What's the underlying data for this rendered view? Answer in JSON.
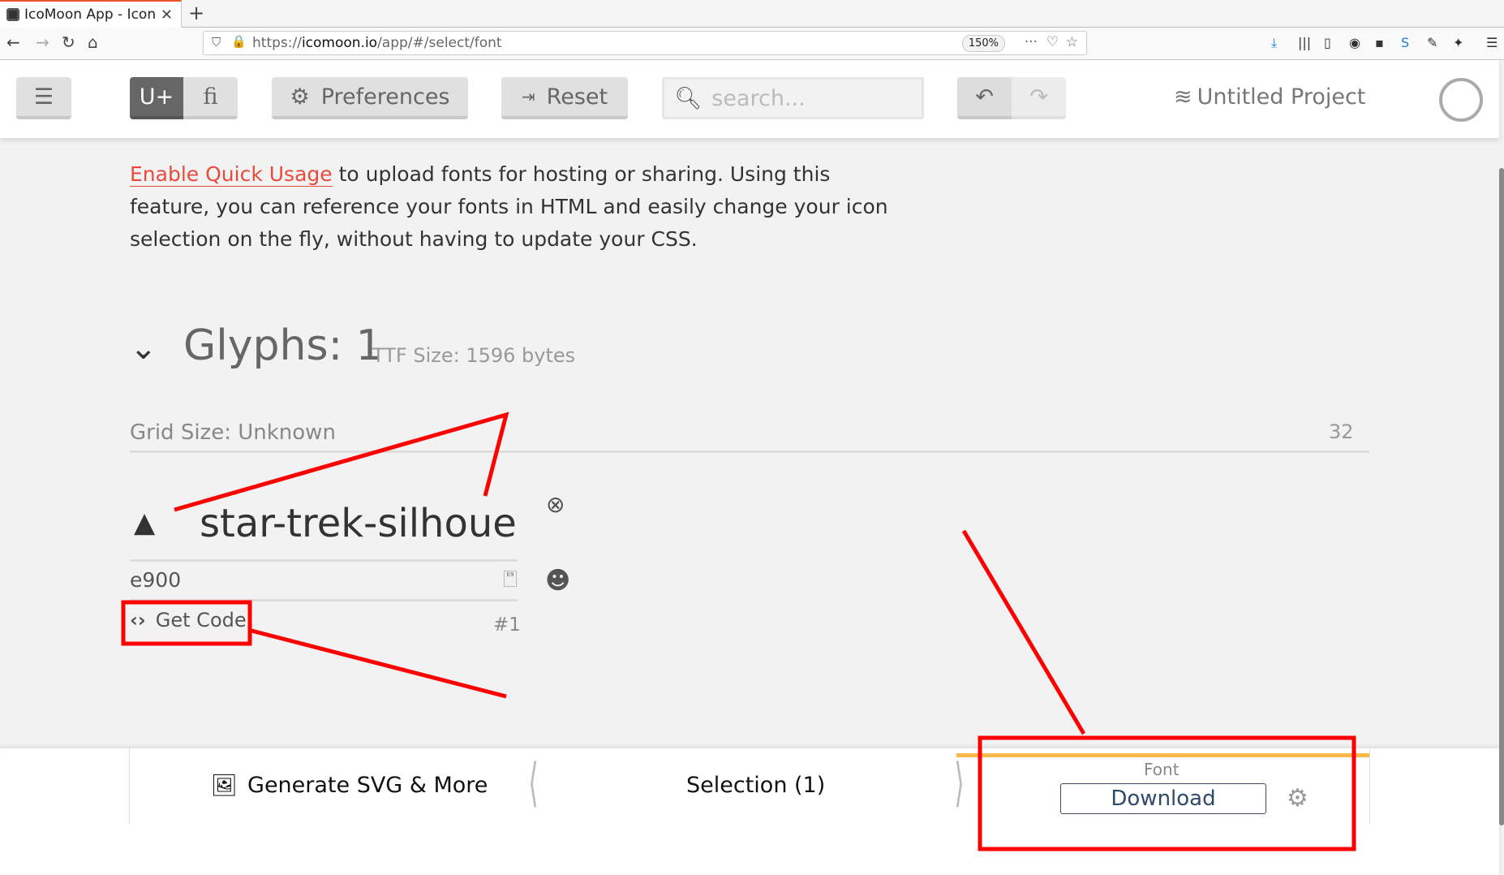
{
  "browser": {
    "tab_title": "IcoMoon App - Icon",
    "url_prefix": "https://",
    "url_domain": "icomoon.io",
    "url_path": "/app/#/select/font",
    "zoom": "150%"
  },
  "toolbar": {
    "unicode_label": "U+",
    "ligature_label": "fi",
    "preferences_label": "Preferences",
    "reset_label": "Reset",
    "search_placeholder": "search...",
    "project_name": "Untitled Project"
  },
  "intro": {
    "link": "Enable Quick Usage",
    "text": " to upload fonts for hosting or sharing. Using this feature, you can reference your fonts in HTML and easily change your icon selection on the fly, without having to update your CSS."
  },
  "glyph_set": {
    "title": "Glyphs: 1",
    "ttf_size": "TTF Size: 1596 bytes",
    "grid_size": "Grid Size: Unknown",
    "grid_value": "32"
  },
  "glyph": {
    "name": "star-trek-silhouette",
    "code": "e900",
    "get_code_label": "Get Code",
    "index": "#1"
  },
  "bottom_bar": {
    "generate_label": "Generate SVG & More",
    "selection_label": "Selection (1)",
    "font_label": "Font",
    "download_label": "Download"
  },
  "colors": {
    "annotation": "#ff0000",
    "accent": "#fcb94b",
    "link": "#e74c3c"
  }
}
